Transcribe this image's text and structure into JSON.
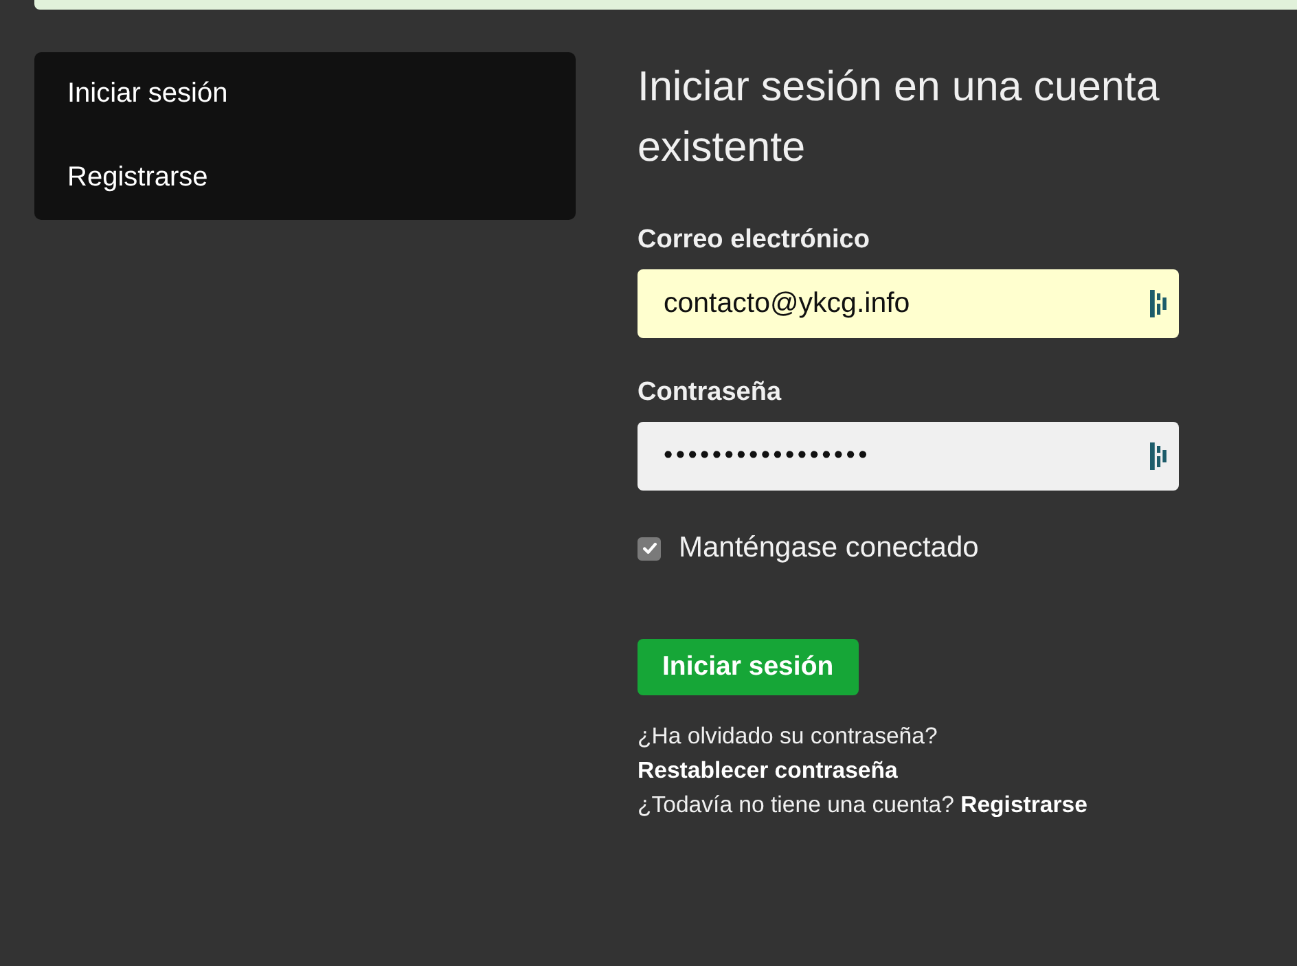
{
  "sidebar": {
    "items": [
      {
        "label": "Iniciar sesión"
      },
      {
        "label": "Registrarse"
      }
    ]
  },
  "form": {
    "title": "Iniciar sesión en una cuenta existente",
    "fields": [
      {
        "kind": "email",
        "label": "Correo electrónico",
        "value": "contacto@ykcg.info",
        "autofilled": true
      },
      {
        "kind": "password",
        "label": "Contraseña",
        "value": "•••••••••••••••••",
        "autofilled": false
      }
    ],
    "remember": {
      "label": "Manténgase conectado",
      "checked": true
    },
    "submit": "Iniciar sesión",
    "help": [
      {
        "prompt": "¿Ha olvidado su contraseña?",
        "link": "Restablecer contraseña"
      },
      {
        "prompt": "¿Todavía no tiene una cuenta?",
        "link": "Registrarse"
      }
    ]
  }
}
